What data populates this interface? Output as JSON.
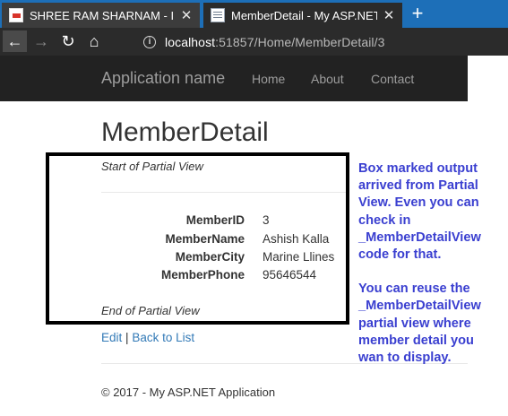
{
  "browser": {
    "tabs": [
      {
        "title": "SHREE RAM SHARNAM - Intern",
        "active": false,
        "favicon": "red-logo-icon"
      },
      {
        "title": "MemberDetail - My ASP.NET Ap",
        "active": true,
        "favicon": "page-icon"
      }
    ],
    "new_tab_label": "+",
    "close_label": "✕",
    "nav": {
      "back": "←",
      "forward": "→",
      "reload": "↻",
      "home": "⌂"
    },
    "info_icon": "i",
    "url_host": "localhost",
    "url_path": ":51857/Home/MemberDetail/3"
  },
  "site_nav": {
    "brand": "Application name",
    "links": [
      "Home",
      "About",
      "Contact"
    ]
  },
  "page": {
    "title": "MemberDetail",
    "partial_start": "Start of Partial View",
    "partial_end": "End of Partial View",
    "fields": [
      {
        "label": "MemberID",
        "value": "3"
      },
      {
        "label": "MemberName",
        "value": "Ashish Kalla"
      },
      {
        "label": "MemberCity",
        "value": "Marine Llines"
      },
      {
        "label": "MemberPhone",
        "value": "95646544"
      }
    ],
    "edit_link": "Edit",
    "separator": "|",
    "back_link": "Back to List",
    "footer": "© 2017 - My ASP.NET Application"
  },
  "annotation": {
    "para1": "Box marked output arrived from Partial View. Even you can check in _MemberDetailView code for that.",
    "para2": "You can reuse the _MemberDetailView partial view where member detail you wan to display."
  },
  "colors": {
    "tabstrip": "#1d6fb8",
    "navbar": "#222222",
    "link": "#337ab7",
    "annotation": "#3a3fd0"
  }
}
